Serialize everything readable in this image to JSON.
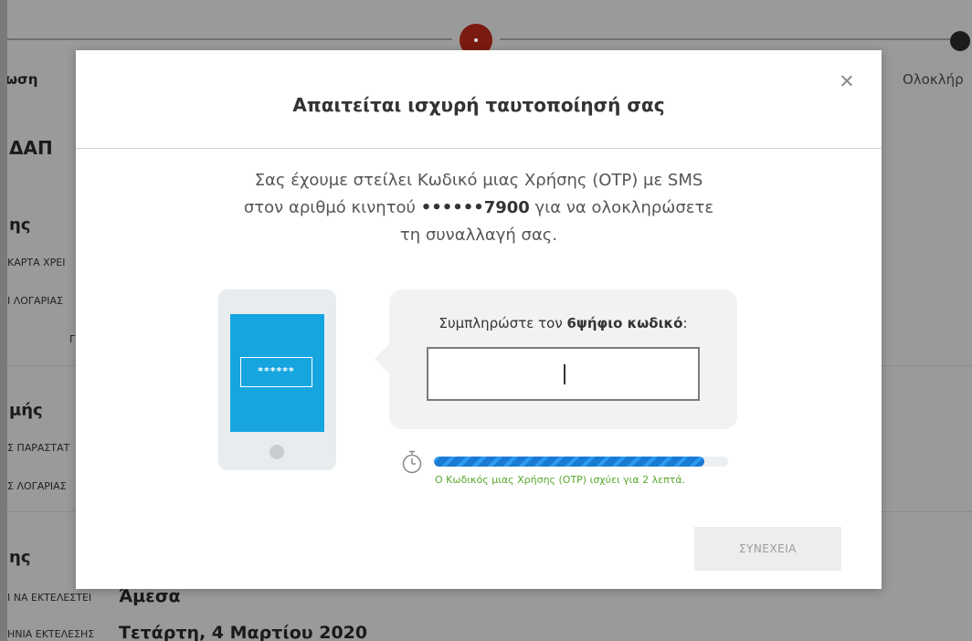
{
  "background": {
    "step_left_label": "ωση",
    "step_right_label": "Ολοκλήρ",
    "heading_partial": "ΔΑΠ",
    "section1_partial": "ης",
    "row1_label": "ΚΑΡΤΑ ΧΡΕΙ",
    "row2_label": "Ι ΛΟΓΑΡΙΑΣ",
    "row3_label": "Γ",
    "section2_partial": "μής",
    "row4_label": "Σ ΠΑΡΑΣΤΑΤ",
    "row5_label": "Σ ΛΟΓΑΡΙΑΣ",
    "section3_partial": "ης",
    "row6_label": "Ι ΝΑ ΕΚΤΕΛΕΣΤΕΙ",
    "row6_value": "Άμεσα",
    "row7_label": "ΗΝΙΑ ΕΚΤΕΛΕΣΗΣ",
    "row7_value": "Τετάρτη, 4 Μαρτίου 2020"
  },
  "modal": {
    "title": "Απαιτείται ισχυρή ταυτοποίησή σας",
    "message_line1": "Σας έχουμε στείλει Κωδικό μιας Χρήσης (OTP) με SMS",
    "message_line2_prefix": "στον αριθμό κινητού ",
    "masked_number": "••••••7900",
    "message_line2_suffix": " για να ολοκληρώσετε",
    "message_line3": "τη συναλλαγή σας.",
    "phone_pin": "******",
    "input_label_prefix": "Συμπληρώστε τον ",
    "input_label_bold": "6ψήφιο κωδικό",
    "input_label_suffix": ":",
    "input_value": "",
    "timer_text": "Ο Κωδικός μιας Χρήσης (OTP) ισχύει για 2 λεπτά.",
    "progress_fraction": 0.92,
    "continue_label": "ΣΥΝΕΧΕΙΑ"
  },
  "colors": {
    "accent_blue": "#17a5e0",
    "progress_blue": "#1b7bd2",
    "timer_green": "#5aa72e",
    "step_active": "#8b1e12"
  }
}
